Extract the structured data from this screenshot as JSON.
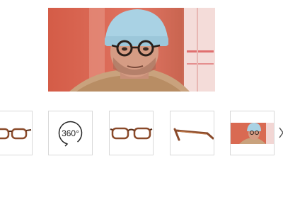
{
  "gallery": {
    "main_image": {
      "icon": "person-wearing-glasses-photo",
      "alt": ""
    },
    "thumbnails": [
      {
        "name": "glasses-front-view",
        "icon": "glasses-front-icon"
      },
      {
        "name": "360-view",
        "icon": "rotate-360-icon",
        "label": "360°"
      },
      {
        "name": "glasses-front-view",
        "icon": "glasses-front-icon"
      },
      {
        "name": "glasses-side-view",
        "icon": "glasses-side-icon"
      },
      {
        "name": "model-photo",
        "icon": "person-photo-icon"
      }
    ],
    "next_icon": "chevron-right-icon"
  },
  "colors": {
    "thumb_border": "#d9d9d9",
    "frame_tortoise": "#8a4a2a",
    "frame_dark": "#5a2e18",
    "photo_bg": "#d96a52",
    "beanie": "#a9d2e4"
  }
}
